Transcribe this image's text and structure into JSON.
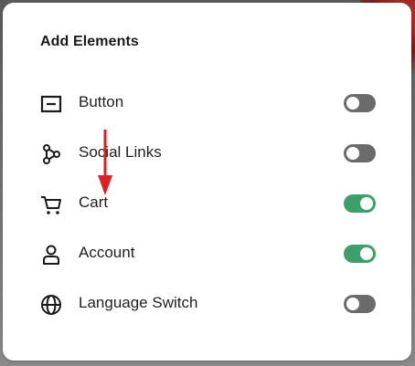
{
  "panel": {
    "title": "Add Elements"
  },
  "elements": [
    {
      "label": "Button",
      "icon": "button-icon",
      "enabled": false
    },
    {
      "label": "Social Links",
      "icon": "share-icon",
      "enabled": false
    },
    {
      "label": "Cart",
      "icon": "cart-icon",
      "enabled": true
    },
    {
      "label": "Account",
      "icon": "user-icon",
      "enabled": true
    },
    {
      "label": "Language Switch",
      "icon": "globe-icon",
      "enabled": false
    }
  ],
  "colors": {
    "toggle_on": "#3d9f6a",
    "toggle_off": "#6b6b6b",
    "annotation_arrow": "#e02020"
  }
}
